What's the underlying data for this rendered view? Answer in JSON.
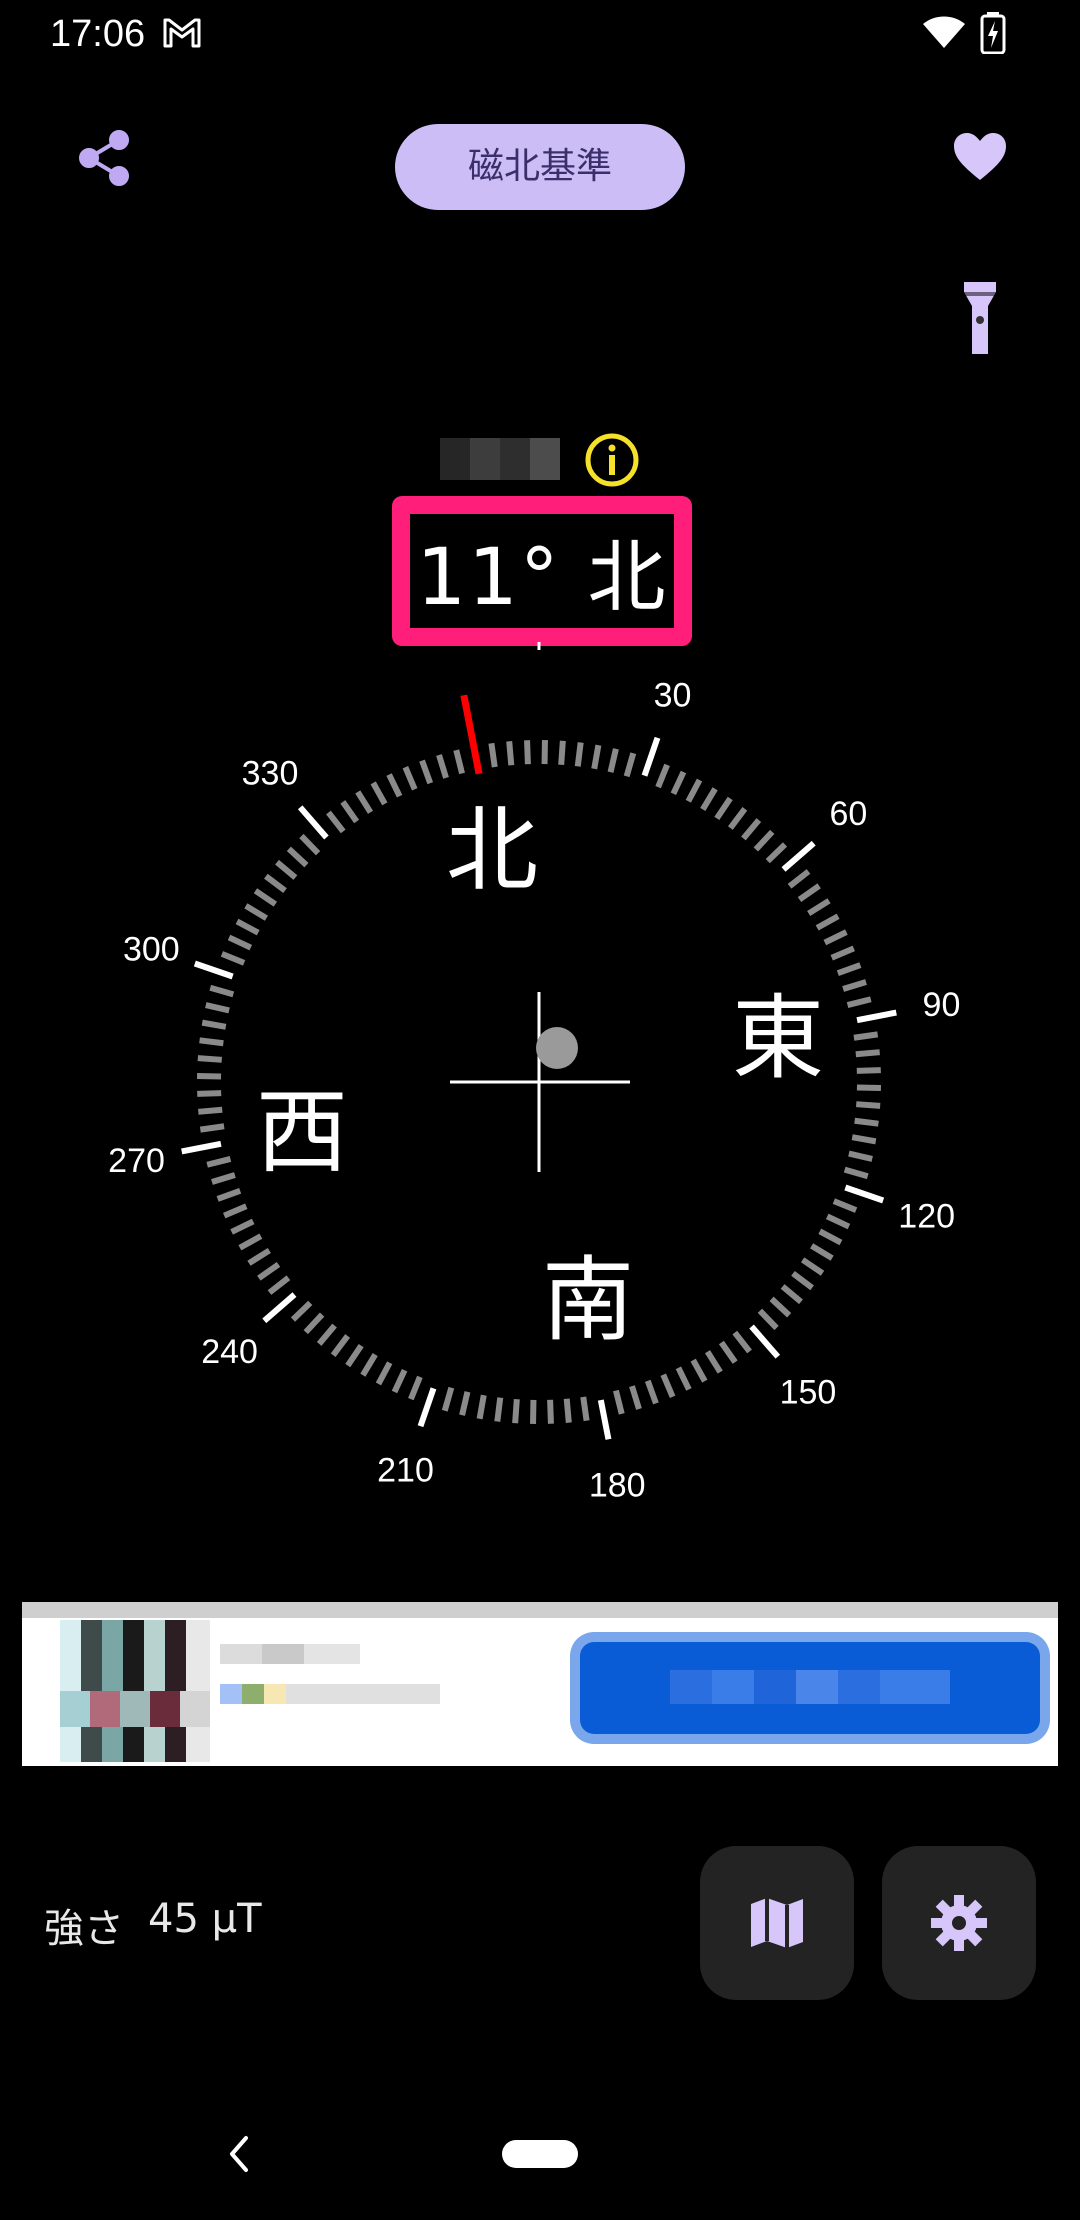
{
  "status_bar": {
    "time": "17:06",
    "notification_icon": "gmail-icon",
    "wifi_icon": "wifi-icon",
    "battery_icon": "battery-charging-icon"
  },
  "toolbar": {
    "reference_mode_label": "磁北基準",
    "share_icon": "share-icon",
    "favorite_icon": "heart-icon",
    "flashlight_icon": "flashlight-icon",
    "accent_color": "#cdbdf6"
  },
  "heading": {
    "info_icon": "info-icon",
    "text": "11° 北",
    "highlight_color": "#ff1f7a"
  },
  "compass": {
    "heading_deg": 11,
    "cardinals": {
      "north": "北",
      "east": "東",
      "south": "南",
      "west": "西"
    },
    "degree_labels": [
      "30",
      "60",
      "90",
      "120",
      "150",
      "180",
      "210",
      "240",
      "270",
      "300",
      "330"
    ],
    "needle_color": "#ff0000"
  },
  "bottom": {
    "strength_label": "強さ",
    "strength_value": "45 μT",
    "map_icon": "map-icon",
    "settings_icon": "gear-icon"
  }
}
